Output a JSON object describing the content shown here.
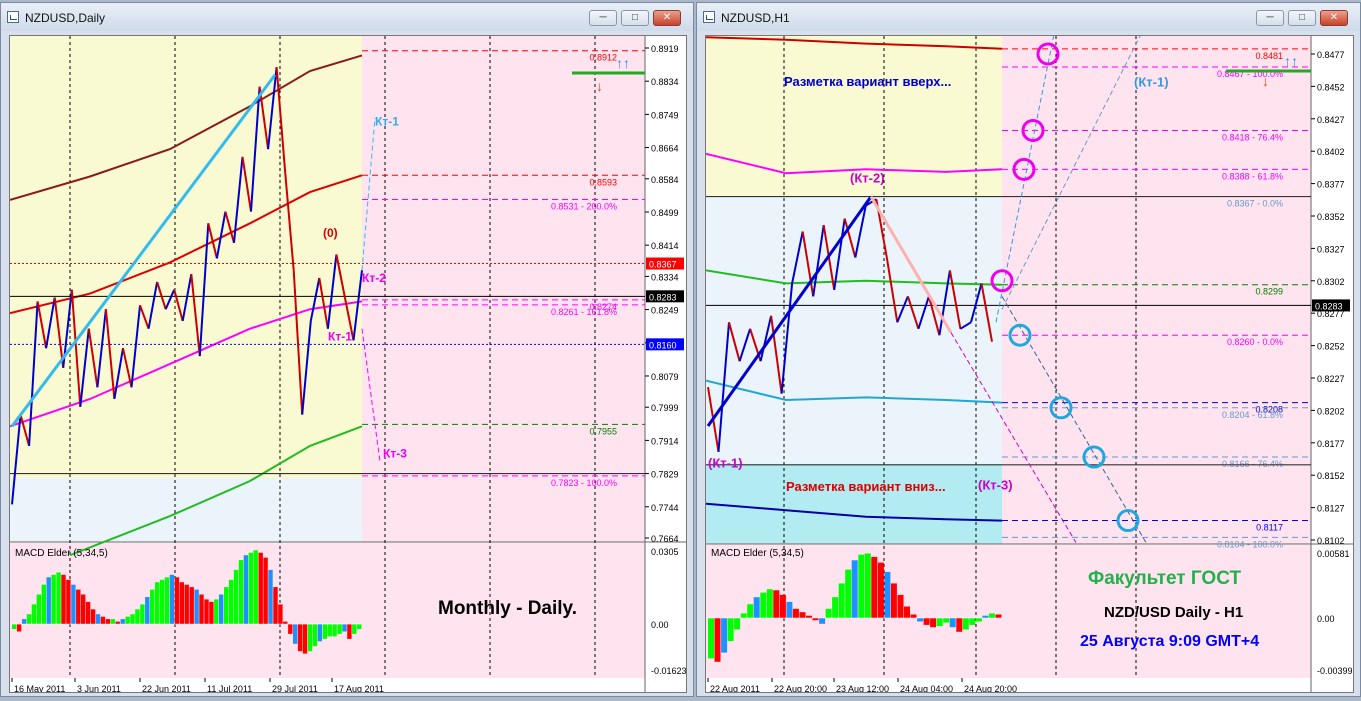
{
  "left": {
    "title": "NZDUSD,Daily",
    "indicator_label": "MACD Elder (5,34,5)",
    "main_text": "Monthly - Daily.",
    "chart_labels": {
      "kt1": "Кт-1",
      "kt2": "Кт-2",
      "kt3": "Кт-3",
      "zero": "(0)"
    }
  },
  "right": {
    "title": "NZDUSD,H1",
    "indicator_label": "MACD Elder (5,34,5)",
    "note_up": "Разметка вариант вверх...",
    "note_down": "Разметка вариант вниз...",
    "chart_labels": {
      "kt1_top": "(Кт-1)",
      "kt2": "(Кт-2)",
      "kt1_left": "(Кт-1)",
      "kt3": "(Кт-3)"
    },
    "brand": "Факультет ГОСТ",
    "pair": "NZD/USD Daily - H1",
    "date_text": "25  Августа 9:09 GMT+4"
  },
  "chart_data": [
    {
      "type": "line",
      "name": "NZDUSD Daily",
      "price_axis": [
        "0.8919",
        "0.8834",
        "0.8749",
        "0.8664",
        "0.8584",
        "0.8499",
        "0.8414",
        "0.8334",
        "0.8249",
        "0.8164",
        "0.8079",
        "0.7999",
        "0.7914",
        "0.7829",
        "0.7744",
        "0.7664"
      ],
      "current_price": "0.8283",
      "price_boxes": [
        {
          "value": "0.8367",
          "color": "#ff0000"
        },
        {
          "value": "0.8160",
          "color": "#0000ff"
        }
      ],
      "levels": [
        {
          "price": "0.8912",
          "label": "0.8912",
          "color": "#ff0000"
        },
        {
          "price": "0.8593",
          "label": "0.8593",
          "color": "#ff0000"
        },
        {
          "price": "0.8531",
          "label": "0.8531 - 200.0%",
          "color": "#ff00ff"
        },
        {
          "price": "0.8274",
          "label": "0.8274",
          "color": "#ff00ff"
        },
        {
          "price": "0.8261",
          "label": "0.8261 - 161.8%",
          "color": "#ff00ff"
        },
        {
          "price": "0.7955",
          "label": "0.7955",
          "color": "#008000"
        },
        {
          "price": "0.7823",
          "label": "0.7823 - 100.0%",
          "color": "#ff00ff"
        }
      ],
      "zigzag": [
        0.775,
        0.798,
        0.79,
        0.827,
        0.815,
        0.828,
        0.81,
        0.83,
        0.8,
        0.82,
        0.805,
        0.825,
        0.802,
        0.815,
        0.805,
        0.826,
        0.82,
        0.832,
        0.825,
        0.83,
        0.822,
        0.834,
        0.813,
        0.847,
        0.838,
        0.85,
        0.842,
        0.864,
        0.85,
        0.882,
        0.866,
        0.887,
        0.86,
        0.835,
        0.798,
        0.822,
        0.833,
        0.82,
        0.839,
        0.828,
        0.817,
        0.835
      ],
      "macd_axis": [
        "0.0305",
        "0.00",
        "-0.01623"
      ],
      "macd": [
        -0.002,
        -0.003,
        0.002,
        0.004,
        0.008,
        0.012,
        0.016,
        0.019,
        0.02,
        0.021,
        0.02,
        0.018,
        0.016,
        0.014,
        0.012,
        0.009,
        0.006,
        0.004,
        0.003,
        0.002,
        0.002,
        0.001,
        0.002,
        0.003,
        0.004,
        0.006,
        0.008,
        0.011,
        0.014,
        0.017,
        0.018,
        0.019,
        0.02,
        0.019,
        0.017,
        0.016,
        0.015,
        0.014,
        0.012,
        0.01,
        0.009,
        0.01,
        0.012,
        0.015,
        0.018,
        0.022,
        0.026,
        0.028,
        0.029,
        0.03,
        0.029,
        0.027,
        0.022,
        0.015,
        0.008,
        0.001,
        -0.004,
        -0.008,
        -0.011,
        -0.012,
        -0.011,
        -0.009,
        -0.007,
        -0.006,
        -0.005,
        -0.005,
        -0.004,
        -0.003,
        -0.006,
        -0.004,
        -0.002
      ],
      "x_labels": [
        "16 May 2011",
        "3 Jun 2011",
        "22 Jun 2011",
        "11 Jul 2011",
        "29 Jul 2011",
        "17 Aug 2011"
      ]
    },
    {
      "type": "line",
      "name": "NZDUSD H1",
      "price_axis": [
        "0.8477",
        "0.8452",
        "0.8427",
        "0.8402",
        "0.8377",
        "0.8352",
        "0.8327",
        "0.8302",
        "0.8277",
        "0.8252",
        "0.8227",
        "0.8202",
        "0.8177",
        "0.8152",
        "0.8127",
        "0.8102"
      ],
      "current_price": "0.8283",
      "levels": [
        {
          "price": "0.8481",
          "label": "0.8481",
          "color": "#ff0000"
        },
        {
          "price": "0.8467",
          "label": "0.8467 - 100.0%",
          "color": "#ff00ff"
        },
        {
          "price": "0.8418",
          "label": "0.8418 - 76.4%",
          "color": "#ff00ff"
        },
        {
          "price": "0.8388",
          "label": "0.8388 - 61.8%",
          "color": "#ff00ff"
        },
        {
          "price": "0.8367",
          "label": "0.8367 - 0.0%",
          "color": "#6699cc"
        },
        {
          "price": "0.8299",
          "label": "0.8299",
          "color": "#008000"
        },
        {
          "price": "0.8260",
          "label": "0.8260 - 0.0%",
          "color": "#ff00ff"
        },
        {
          "price": "0.8208",
          "label": "0.8208",
          "color": "#0000cd"
        },
        {
          "price": "0.8204",
          "label": "0.8204 - 61.8%",
          "color": "#6699cc"
        },
        {
          "price": "0.8166",
          "label": "0.8166 - 76.4%",
          "color": "#6699cc"
        },
        {
          "price": "0.8117",
          "label": "0.8117",
          "color": "#0000ff"
        },
        {
          "price": "0.8104",
          "label": "0.8104 - 100.0%",
          "color": "#6699cc"
        }
      ],
      "zigzag": [
        0.822,
        0.817,
        0.827,
        0.824,
        0.8265,
        0.824,
        0.8275,
        0.8215,
        0.83,
        0.834,
        0.829,
        0.8345,
        0.8295,
        0.835,
        0.832,
        0.836,
        0.8365,
        0.832,
        0.827,
        0.829,
        0.8265,
        0.829,
        0.826,
        0.831,
        0.8265,
        0.827,
        0.83,
        0.8255
      ],
      "macd_axis": [
        "0.00581",
        "0.00",
        "-0.00399"
      ],
      "macd": [
        -0.0035,
        -0.0038,
        -0.003,
        -0.002,
        -0.001,
        0.0004,
        0.0012,
        0.0018,
        0.0022,
        0.0025,
        0.0024,
        0.002,
        0.0014,
        0.0008,
        0.0005,
        0.0002,
        -0.0002,
        -0.0005,
        0.0008,
        0.0018,
        0.003,
        0.0042,
        0.005,
        0.0055,
        0.0056,
        0.0053,
        0.0048,
        0.004,
        0.003,
        0.002,
        0.001,
        0.0003,
        -0.0003,
        -0.0006,
        -0.0008,
        -0.0007,
        -0.0004,
        -0.0008,
        -0.0012,
        -0.001,
        -0.0006,
        -0.0003,
        0.0002,
        0.0004,
        0.0003
      ],
      "x_labels": [
        "22 Aug 2011",
        "22 Aug 20:00",
        "23 Aug 12:00",
        "24 Aug 04:00",
        "24 Aug 20:00"
      ]
    }
  ],
  "colors": {
    "bull": "#00ff00",
    "bear": "#ff0000",
    "neutral": "#1e90ff",
    "zigUp": "#0000cc",
    "zigDown": "#cc0000",
    "yellowZone": "#fafad2",
    "pinkZone": "#ffe4ef",
    "blueZone": "#eaf4fa",
    "cyanZone": "#b2ebf2"
  }
}
